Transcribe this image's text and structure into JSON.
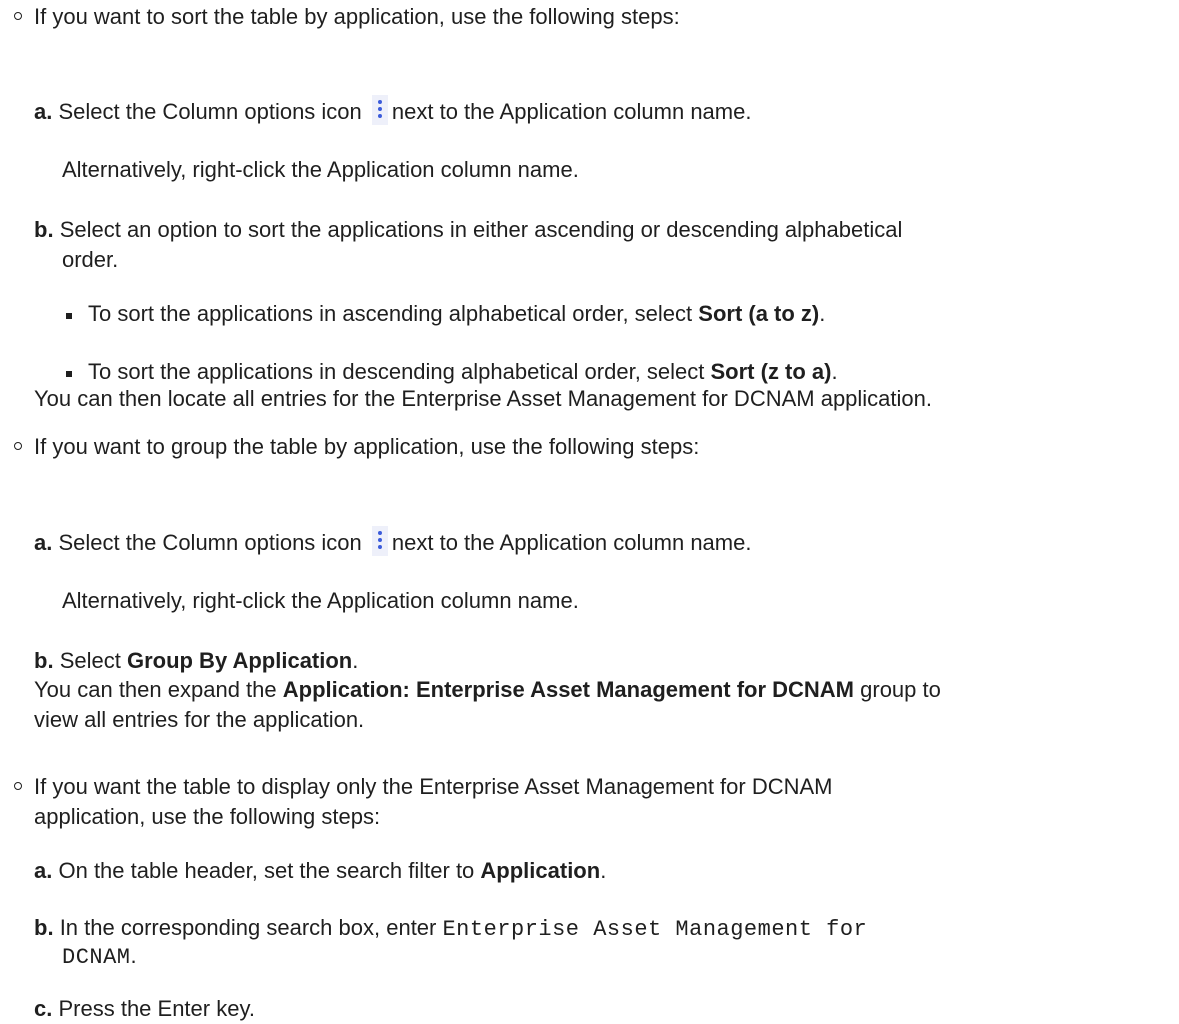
{
  "sections": [
    {
      "intro": "If you want to sort the table by application, use the following steps:",
      "step_a": {
        "marker": "a.",
        "pre": "Select the Column options icon",
        "post": "next to the Application column name.",
        "icon": "vertical-ellipsis-icon"
      },
      "step_a_alt": "Alternatively, right-click the Application column name.",
      "step_b": {
        "marker": "b.",
        "line1": "Select an option to sort the applications in either ascending or descending alphabetical",
        "line2": "order."
      },
      "sub_items": [
        {
          "pre": "To sort the applications in ascending alphabetical order, select ",
          "bold": "Sort (a to z)",
          "post": "."
        },
        {
          "pre": "To sort the applications in descending alphabetical order, select ",
          "bold": "Sort (z to a)",
          "post": "."
        }
      ],
      "result": "You can then locate all entries for the Enterprise Asset Management for DCNAM application."
    },
    {
      "intro": "If you want to group the table by application, use the following steps:",
      "step_a": {
        "marker": "a.",
        "pre": "Select the Column options icon",
        "post": "next to the Application column name.",
        "icon": "vertical-ellipsis-icon"
      },
      "step_a_alt": "Alternatively, right-click the Application column name.",
      "step_b": {
        "marker": "b.",
        "pre": "Select ",
        "bold": "Group By Application",
        "post": "."
      },
      "result": {
        "pre": "You can then expand the ",
        "bold": "Application: Enterprise Asset Management for DCNAM",
        "post": " group to",
        "line2": "view all entries for the application."
      }
    },
    {
      "intro_line1": "If you want the table to display only the Enterprise Asset Management for DCNAM",
      "intro_line2": "application, use the following steps:",
      "step_a": {
        "marker": "a.",
        "pre": "On the table header, set the search filter to ",
        "bold": "Application",
        "post": "."
      },
      "step_b": {
        "marker": "b.",
        "pre": "In the corresponding search box, enter ",
        "code1": "Enterprise Asset Management for",
        "code2": "DCNAM",
        "post": "."
      },
      "step_c": {
        "marker": "c.",
        "text": "Press the Enter key."
      }
    }
  ],
  "colors": {
    "text": "#1f1f1f",
    "icon_bg": "#eef0fa",
    "icon_dots": "#3b5bdb"
  }
}
